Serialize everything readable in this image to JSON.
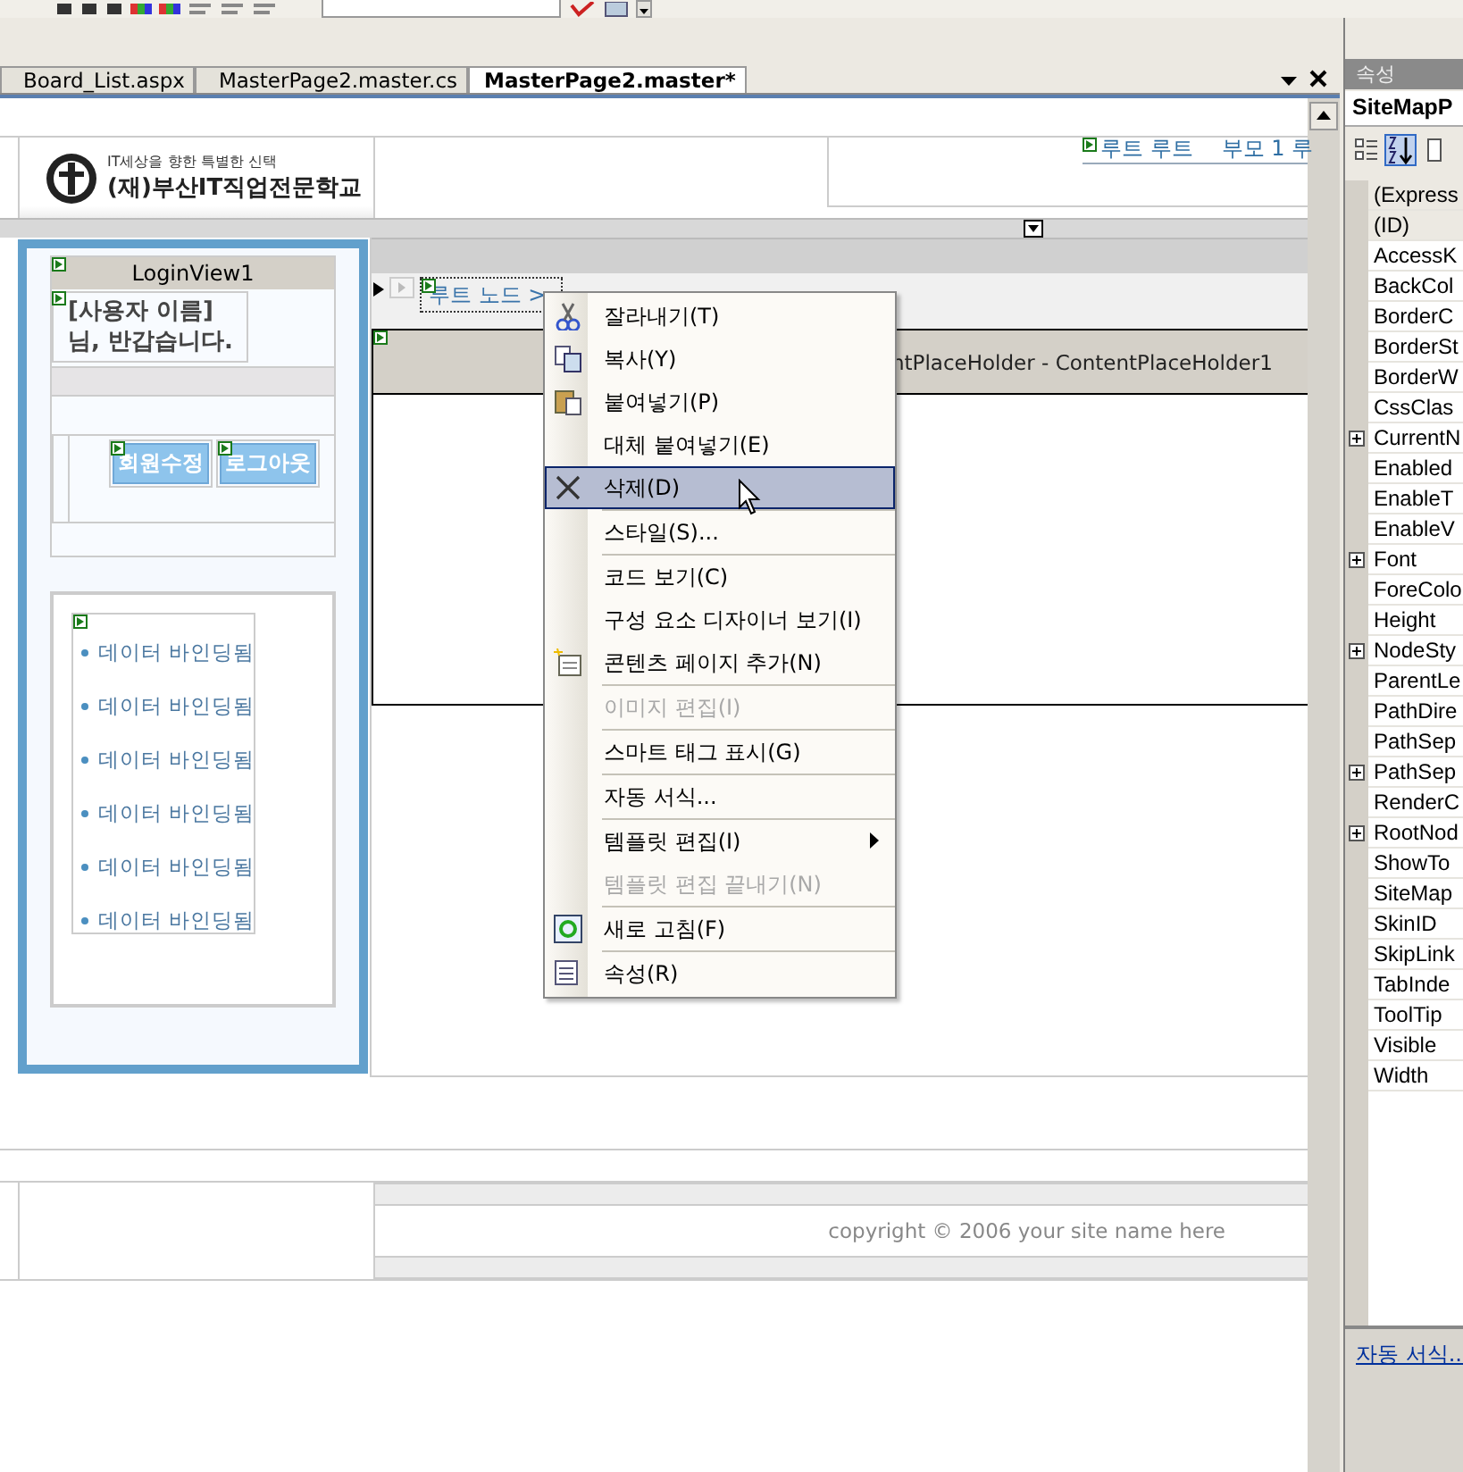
{
  "tabs": [
    {
      "label": "Board_List.aspx",
      "selected": false
    },
    {
      "label": "MasterPage2.master.cs",
      "selected": false
    },
    {
      "label": "MasterPage2.master*",
      "selected": true
    }
  ],
  "designer": {
    "logo": {
      "tagline": "IT세상을 향한 특별한 신택",
      "name": "(재)부산IT직업전문학교"
    },
    "top_breadcrumb": [
      "루트 루트",
      "부모 1 루"
    ],
    "login_view": {
      "title": "LoginView1",
      "greeting": "[사용자 이름]님, 반갑습니다.",
      "buttons": [
        "회원수정",
        "로그아웃"
      ]
    },
    "bound_items": [
      "데이터 바인딩됨",
      "데이터 바인딩됨",
      "데이터 바인딩됨",
      "데이터 바인딩됨",
      "데이터 바인딩됨",
      "데이터 바인딩됨"
    ],
    "site_map_path": "루트 노드 >",
    "content_placeholder": "ntPlaceHolder - ContentPlaceHolder1",
    "footer": "copyright © 2006 your site name here"
  },
  "context_menu": {
    "items": [
      {
        "kind": "item",
        "label": "잘라내기(T)",
        "disabled": false,
        "selected": false,
        "submenu": false
      },
      {
        "kind": "item",
        "label": "복사(Y)",
        "disabled": false,
        "selected": false,
        "submenu": false
      },
      {
        "kind": "item",
        "label": "붙여넣기(P)",
        "disabled": false,
        "selected": false,
        "submenu": false
      },
      {
        "kind": "item",
        "label": "대체 붙여넣기(E)",
        "disabled": false,
        "selected": false,
        "submenu": false
      },
      {
        "kind": "item",
        "label": "삭제(D)",
        "disabled": false,
        "selected": true,
        "submenu": false
      },
      {
        "kind": "separator"
      },
      {
        "kind": "item",
        "label": "스타일(S)...",
        "disabled": false,
        "selected": false,
        "submenu": false
      },
      {
        "kind": "separator"
      },
      {
        "kind": "item",
        "label": "코드 보기(C)",
        "disabled": false,
        "selected": false,
        "submenu": false
      },
      {
        "kind": "item",
        "label": "구성 요소 디자이너 보기(I)",
        "disabled": false,
        "selected": false,
        "submenu": false
      },
      {
        "kind": "item",
        "label": "콘텐츠 페이지 추가(N)",
        "disabled": false,
        "selected": false,
        "submenu": false
      },
      {
        "kind": "separator"
      },
      {
        "kind": "item",
        "label": "이미지 편집(I)",
        "disabled": true,
        "selected": false,
        "submenu": false
      },
      {
        "kind": "separator"
      },
      {
        "kind": "item",
        "label": "스마트 태그 표시(G)",
        "disabled": false,
        "selected": false,
        "submenu": false
      },
      {
        "kind": "separator"
      },
      {
        "kind": "item",
        "label": "자동 서식...",
        "disabled": false,
        "selected": false,
        "submenu": false
      },
      {
        "kind": "separator"
      },
      {
        "kind": "item",
        "label": "템플릿 편집(I)",
        "disabled": false,
        "selected": false,
        "submenu": true
      },
      {
        "kind": "item",
        "label": "템플릿 편집 끝내기(N)",
        "disabled": true,
        "selected": false,
        "submenu": false
      },
      {
        "kind": "separator"
      },
      {
        "kind": "item",
        "label": "새로 고침(F)",
        "disabled": false,
        "selected": false,
        "submenu": false
      },
      {
        "kind": "separator"
      },
      {
        "kind": "item",
        "label": "속성(R)",
        "disabled": false,
        "selected": false,
        "submenu": false
      }
    ]
  },
  "properties": {
    "title": "속성",
    "object": "SiteMapP",
    "link": "자동 서식...",
    "rows": [
      {
        "name": "(Express",
        "kind": "special",
        "expandable": false
      },
      {
        "name": "(ID)",
        "kind": "special",
        "expandable": false
      },
      {
        "name": "AccessK",
        "kind": "normal",
        "expandable": false
      },
      {
        "name": "BackCol",
        "kind": "normal",
        "expandable": false
      },
      {
        "name": "BorderC",
        "kind": "normal",
        "expandable": false
      },
      {
        "name": "BorderSt",
        "kind": "normal",
        "expandable": false
      },
      {
        "name": "BorderW",
        "kind": "normal",
        "expandable": false
      },
      {
        "name": "CssClas",
        "kind": "normal",
        "expandable": false
      },
      {
        "name": "CurrentN",
        "kind": "normal",
        "expandable": true
      },
      {
        "name": "Enabled",
        "kind": "normal",
        "expandable": false
      },
      {
        "name": "EnableT",
        "kind": "normal",
        "expandable": false
      },
      {
        "name": "EnableV",
        "kind": "normal",
        "expandable": false
      },
      {
        "name": "Font",
        "kind": "normal",
        "expandable": true
      },
      {
        "name": "ForeColo",
        "kind": "normal",
        "expandable": false
      },
      {
        "name": "Height",
        "kind": "normal",
        "expandable": false
      },
      {
        "name": "NodeSty",
        "kind": "normal",
        "expandable": true
      },
      {
        "name": "ParentLe",
        "kind": "normal",
        "expandable": false
      },
      {
        "name": "PathDire",
        "kind": "normal",
        "expandable": false
      },
      {
        "name": "PathSep",
        "kind": "normal",
        "expandable": false
      },
      {
        "name": "PathSep",
        "kind": "normal",
        "expandable": true
      },
      {
        "name": "RenderC",
        "kind": "normal",
        "expandable": false
      },
      {
        "name": "RootNod",
        "kind": "normal",
        "expandable": true
      },
      {
        "name": "ShowTo",
        "kind": "normal",
        "expandable": false
      },
      {
        "name": "SiteMap",
        "kind": "normal",
        "expandable": false
      },
      {
        "name": "SkinID",
        "kind": "normal",
        "expandable": false
      },
      {
        "name": "SkipLink",
        "kind": "normal",
        "expandable": false
      },
      {
        "name": "TabInde",
        "kind": "normal",
        "expandable": false
      },
      {
        "name": "ToolTip",
        "kind": "normal",
        "expandable": false
      },
      {
        "name": "Visible",
        "kind": "normal",
        "expandable": false
      },
      {
        "name": "Width",
        "kind": "normal",
        "expandable": false
      }
    ]
  }
}
